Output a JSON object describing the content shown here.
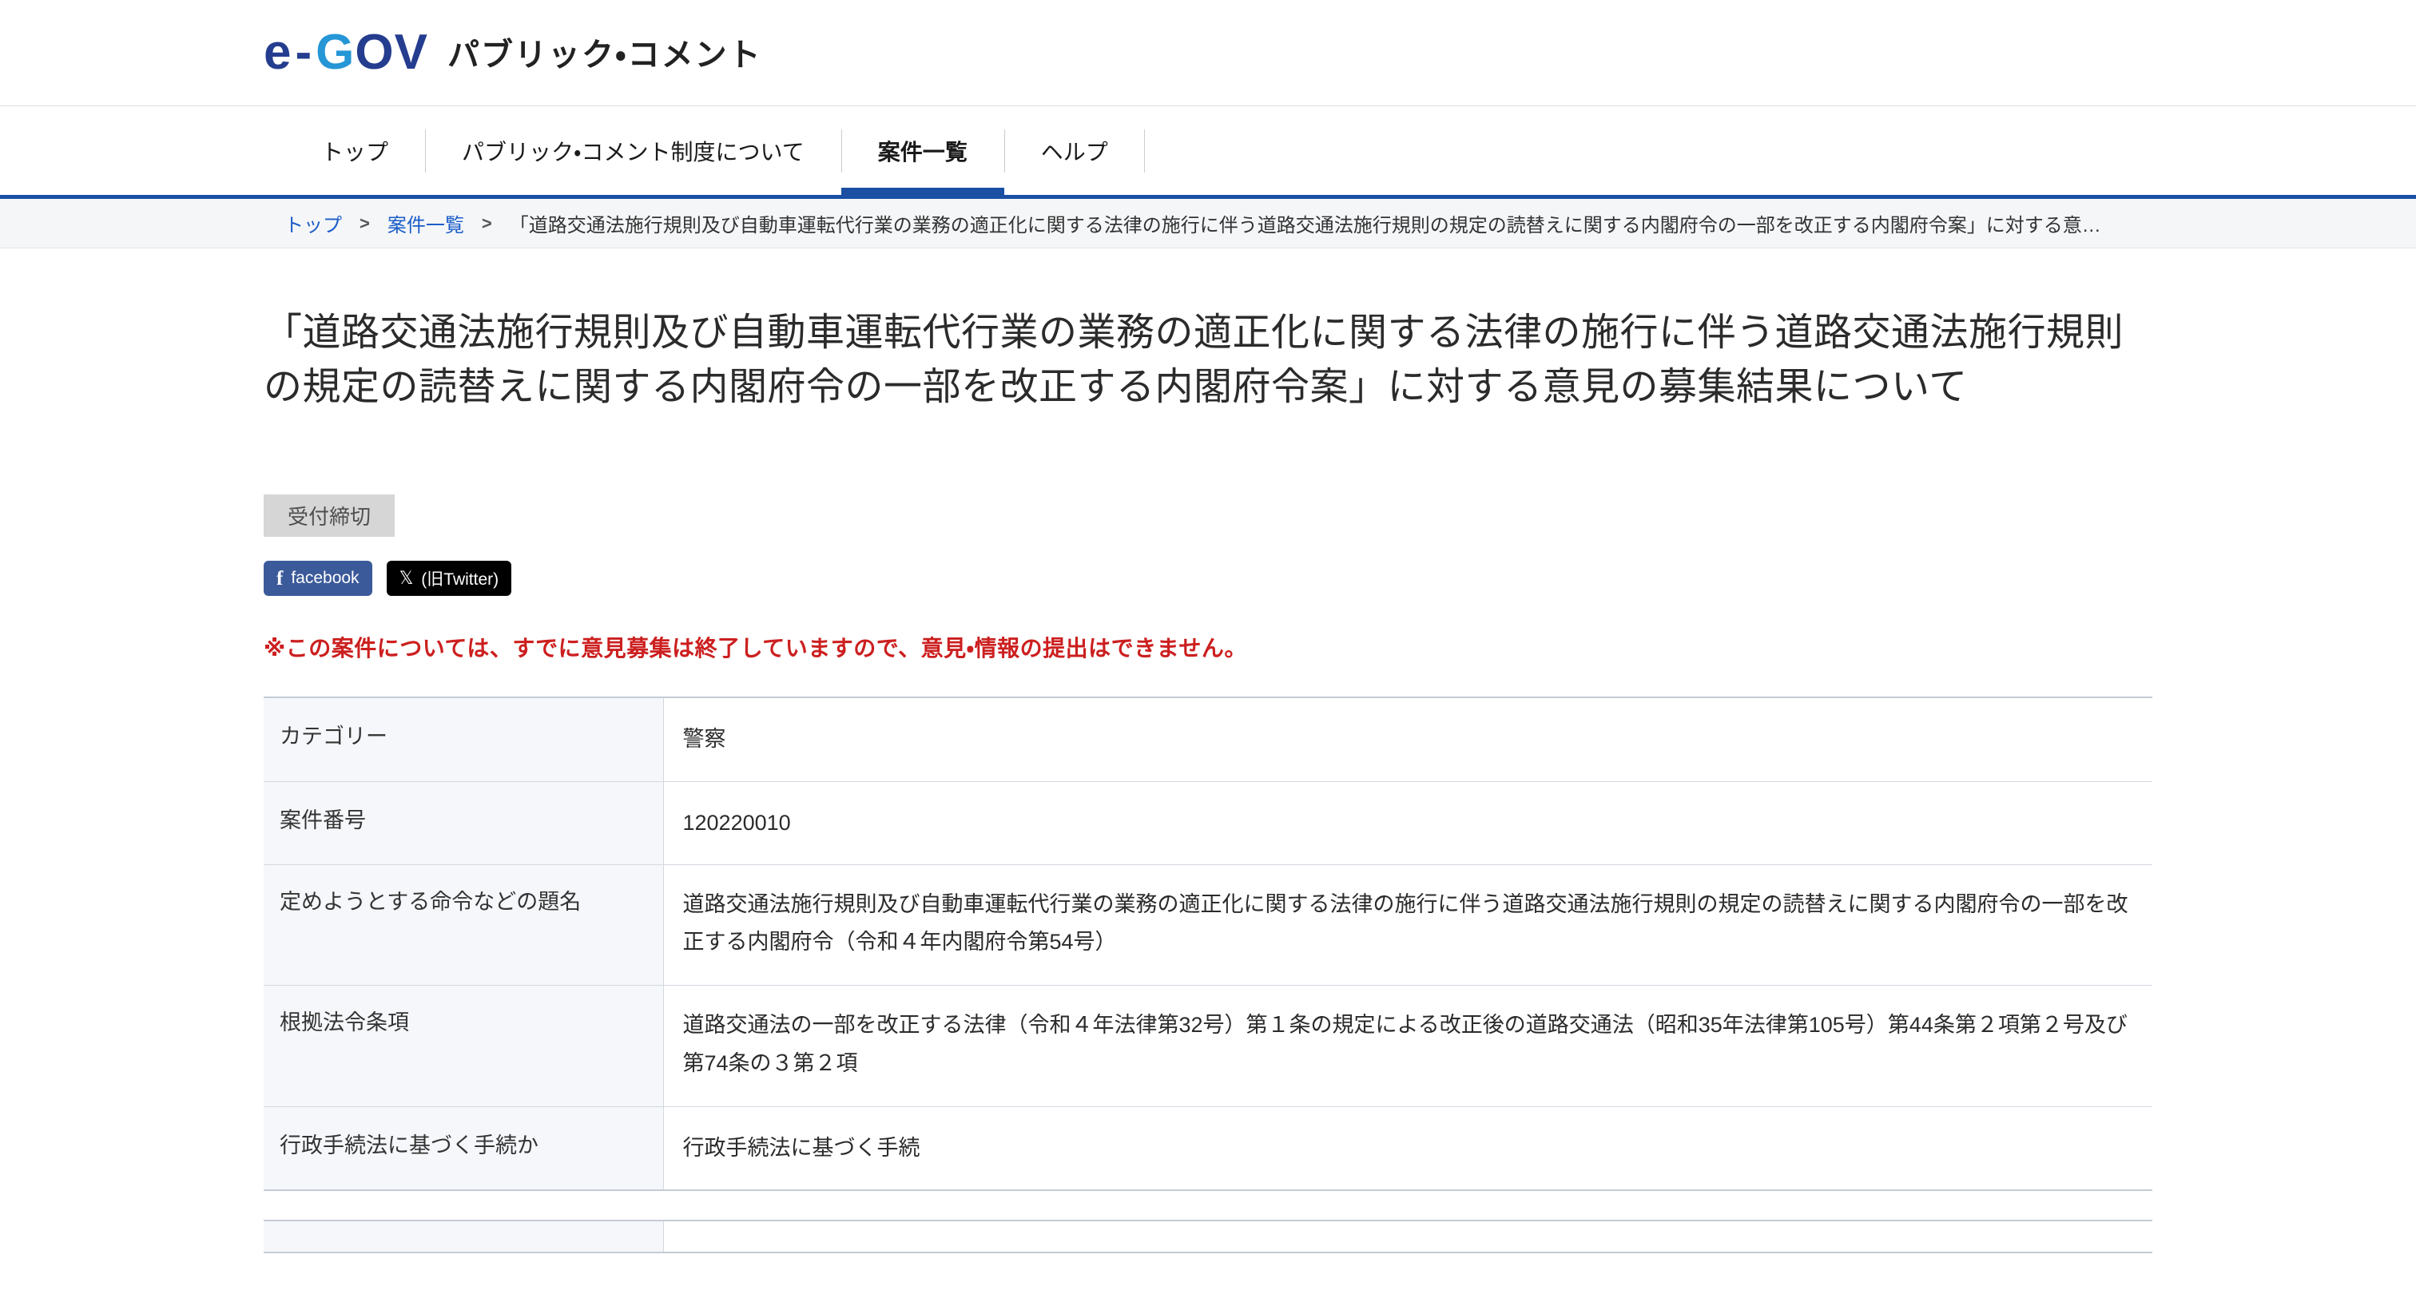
{
  "header": {
    "logo": {
      "letters": [
        "e",
        "-",
        "G",
        "O",
        "V"
      ],
      "service_name": "パブリック・コメント",
      "color_navy": "#253d8f",
      "color_lightblue": "#2596d6"
    }
  },
  "nav": {
    "items": [
      {
        "label": "トップ",
        "active": false
      },
      {
        "label": "パブリック・コメント制度について",
        "active": false
      },
      {
        "label": "案件一覧",
        "active": true
      },
      {
        "label": "ヘルプ",
        "active": false
      }
    ],
    "active_color": "#1a4fa3"
  },
  "breadcrumb": {
    "items": [
      {
        "label": "トップ",
        "link": true
      },
      {
        "label": "案件一覧",
        "link": true
      }
    ],
    "separator": "＞",
    "current": "「道路交通法施行規則及び自動車運転代行業の業務の適正化に関する法律の施行に伴う道路交通法施行規則の規定の読替えに関する内閣府令の一部を改正する内閣府令案」に対する意…"
  },
  "main": {
    "page_title": "「道路交通法施行規則及び自動車運転代行業の業務の適正化に関する法律の施行に伴う道路交通法施行規則の規定の読替えに関する内閣府令の一部を改正する内閣府令案」に対する意見の募集結果について",
    "status_badge": "受付締切",
    "status_badge_bg": "#d6d6d6",
    "social": {
      "facebook_label": "facebook",
      "facebook_icon": "facebook-f-icon",
      "facebook_bg": "#3b5a9a",
      "x_label": "(旧Twitter)",
      "x_icon": "x-logo-icon",
      "x_bg": "#000000"
    },
    "notice": "※この案件については、すでに意見募集は終了していますので、意見・情報の提出はできません。",
    "notice_color": "#cc1f1f"
  },
  "info_table": {
    "rows": [
      {
        "label": "カテゴリー",
        "value": "警察"
      },
      {
        "label": "案件番号",
        "value": "120220010"
      },
      {
        "label": "定めようとする命令などの題名",
        "value": "道路交通法施行規則及び自動車運転代行業の業務の適正化に関する法律の施行に伴う道路交通法施行規則の規定の読替えに関する内閣府令の一部を改正する内閣府令（令和４年内閣府令第54号）"
      },
      {
        "label": "根拠法令条項",
        "value": "道路交通法の一部を改正する法律（令和４年法律第32号）第１条の規定による改正後の道路交通法（昭和35年法律第105号）第44条第２項第２号及び第74条の３第２項"
      },
      {
        "label": "行政手続法に基づく手続か",
        "value": "行政手続法に基づく手続"
      }
    ]
  },
  "secondary_table": {
    "rows": [
      {
        "label": "",
        "value": ""
      }
    ]
  }
}
